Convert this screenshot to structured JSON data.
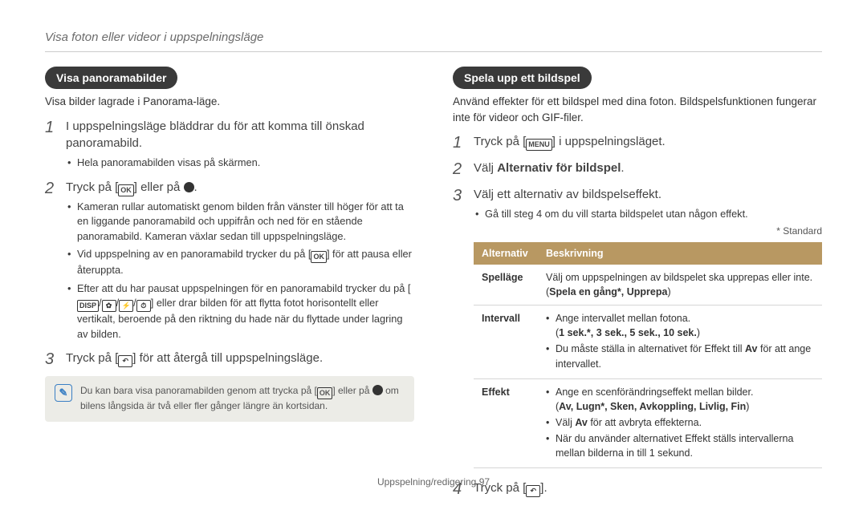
{
  "breadcrumb": "Visa foton eller videor i uppspelningsläge",
  "left": {
    "pill": "Visa panoramabilder",
    "intro": "Visa bilder lagrade i Panorama-läge.",
    "step1": "I uppspelningsläge bläddrar du för att komma till önskad panoramabild.",
    "step1_sub": "Hela panoramabilden visas på skärmen.",
    "step2_a": "Tryck på [",
    "step2_b": "] eller på",
    "step2_c": ".",
    "step2_sub1": "Kameran rullar automatiskt genom bilden från vänster till höger för att ta en liggande panoramabild och uppifrån och ned för en stående panoramabild. Kameran växlar sedan till uppspelningsläge.",
    "step2_sub2_a": "Vid uppspelning av en panoramabild trycker du på [",
    "step2_sub2_b": "] för att pausa eller återuppta.",
    "step2_sub3_a": "Efter att du har pausat uppspelningen för en panoramabild trycker du på [",
    "step2_sub3_b": "] eller drar bilden för att flytta fotot horisontellt eller vertikalt, beroende på den riktning du hade när du flyttade under lagring av bilden.",
    "step3_a": "Tryck på [",
    "step3_b": "] för att återgå till uppspelningsläge.",
    "note_a": "Du kan bara visa panoramabilden genom att trycka på [",
    "note_b": "] eller på",
    "note_c": "om bilens långsida är två eller fler gånger längre än kortsidan.",
    "glyph_ok": "OK",
    "glyph_disp": "DISP",
    "glyph_back": "↶"
  },
  "right": {
    "pill": "Spela upp ett bildspel",
    "intro": "Använd effekter för ett bildspel med dina foton. Bildspelsfunktionen fungerar inte för videor och GIF-filer.",
    "step1_a": "Tryck på [",
    "step1_b": "] i uppspelningsläget.",
    "glyph_menu": "MENU",
    "step2_a": "Välj ",
    "step2_b": "Alternativ för bildspel",
    "step2_c": ".",
    "step3": "Välj ett alternativ av bildspelseffekt.",
    "step3_sub": "Gå till steg 4 om du vill starta bildspelet utan någon effekt.",
    "standard": "* Standard",
    "th1": "Alternativ",
    "th2": "Beskrivning",
    "r1_k": "Spelläge",
    "r1_v_a": "Välj om uppspelningen av bildspelet ska upprepas eller inte.",
    "r1_v_b": "Spela en gång*, Upprepa",
    "r2_k": "Intervall",
    "r2_a": "Ange intervallet mellan fotona.",
    "r2_b": "1 sek.*, 3 sek., 5 sek., 10 sek.",
    "r2_c_a": "Du måste ställa in alternativet för Effekt till ",
    "r2_c_b": "Av",
    "r2_c_c": " för att ange intervallet.",
    "r3_k": "Effekt",
    "r3_a": "Ange en scenförändringseffekt mellan bilder.",
    "r3_b": "Av, Lugn*, Sken, Avkoppling, Livlig, Fin",
    "r3_c_a": "Välj ",
    "r3_c_b": "Av",
    "r3_c_c": " för att avbryta effekterna.",
    "r3_d": "När du använder alternativet Effekt ställs intervallerna mellan bilderna in till 1 sekund.",
    "step4_a": "Tryck på [",
    "step4_b": "]."
  },
  "footer_a": "Uppspelning/redigering  ",
  "footer_b": "97"
}
